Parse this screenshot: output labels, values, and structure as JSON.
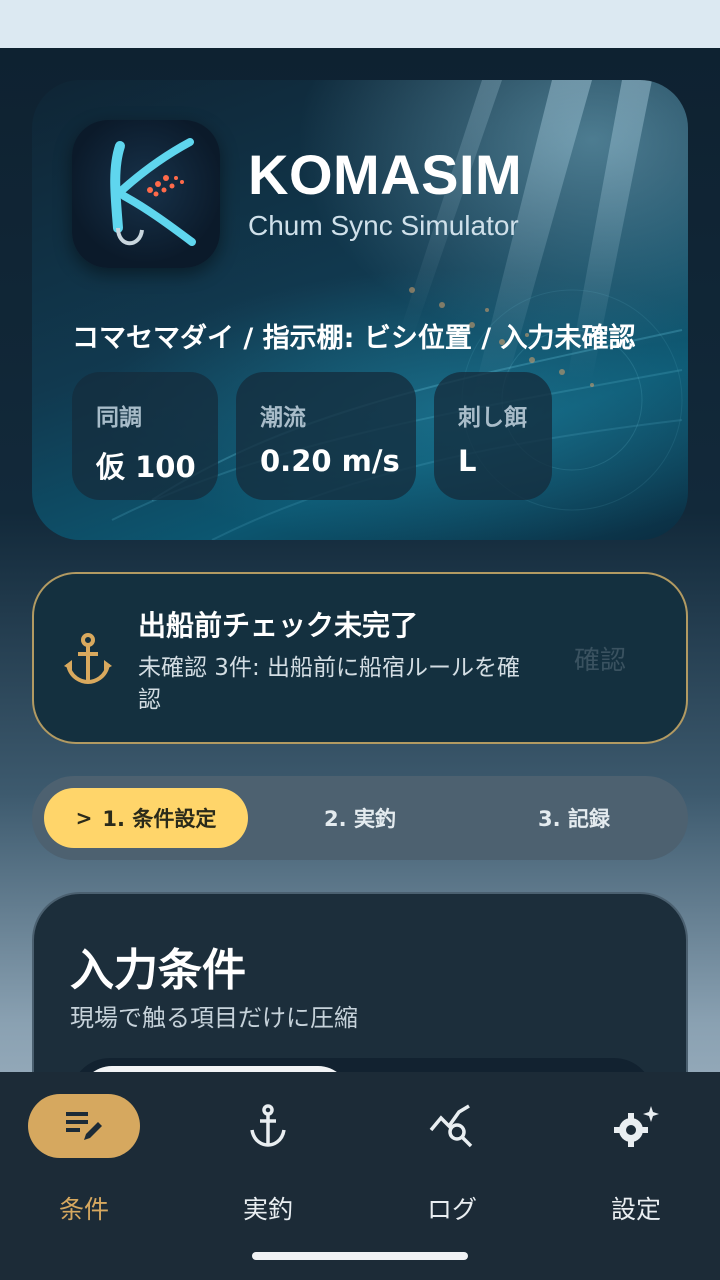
{
  "app": {
    "title": "KOMASIM",
    "subtitle": "Chum Sync Simulator"
  },
  "hero": {
    "condition_line": "コマセマダイ / 指示棚: ビシ位置 / 入力未確認",
    "stats": [
      {
        "label": "同調",
        "value": "仮 100"
      },
      {
        "label": "潮流",
        "value": "0.20 m/s"
      },
      {
        "label": "刺し餌",
        "value": "L"
      }
    ]
  },
  "alert": {
    "icon": "anchor-icon",
    "title": "出船前チェック未完了",
    "body": "未確認 3件: 出船前に船宿ルールを確認",
    "action": "確認"
  },
  "steps": [
    {
      "label": "1. 条件設定",
      "active": true
    },
    {
      "label": "2. 実釣",
      "active": false
    },
    {
      "label": "3. 記録",
      "active": false
    }
  ],
  "inputs": {
    "heading": "入力条件",
    "subheading": "現場で触る項目だけに圧縮"
  },
  "nav": [
    {
      "label": "条件",
      "icon": "edit-list-icon",
      "active": true
    },
    {
      "label": "実釣",
      "icon": "anchor-icon",
      "active": false
    },
    {
      "label": "ログ",
      "icon": "chart-search-icon",
      "active": false
    },
    {
      "label": "設定",
      "icon": "settings-sparkle-icon",
      "active": false
    }
  ],
  "colors": {
    "accent": "#ffd56a",
    "nav_active": "#d6a85f",
    "alert_border": "#b29a62"
  }
}
